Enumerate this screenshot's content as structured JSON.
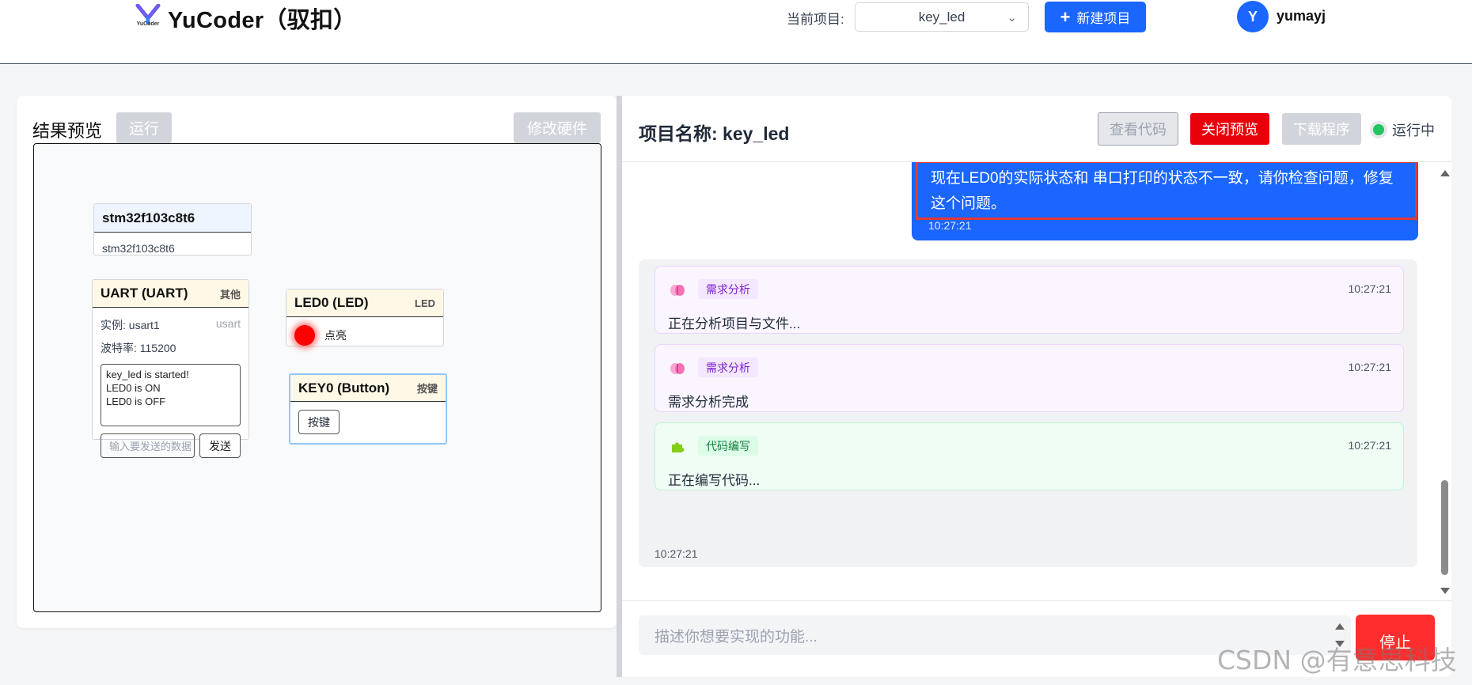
{
  "header": {
    "brand_sub": "YuCoder",
    "app_title": "YuCoder（驭扣）",
    "project_label": "当前项目:",
    "project_value": "key_led",
    "new_project_label": "新建项目",
    "avatar_initial": "Y",
    "username": "yumayj",
    "brand_color": "#1a66ff"
  },
  "left": {
    "title": "结果预览",
    "run_label": "运行",
    "modify_hw_label": "修改硬件",
    "chip": {
      "title": "stm32f103c8t6",
      "body": "stm32f103c8t6"
    },
    "uart": {
      "title": "UART (UART)",
      "tag": "其他",
      "instance_label": "实例: usart1",
      "instance_type": "usart",
      "baud_label": "波特率: 115200",
      "log_lines": [
        "key_led is started!",
        "LED0 is ON",
        "LED0 is OFF"
      ],
      "send_placeholder": "输入要发送的数据",
      "send_label": "发送"
    },
    "led": {
      "title": "LED0 (LED)",
      "tag": "LED",
      "state": "点亮",
      "color": "#ff0000"
    },
    "key": {
      "title": "KEY0 (Button)",
      "tag": "按键",
      "button_label": "按键"
    }
  },
  "right": {
    "title": "项目名称: key_led",
    "view_code_label": "查看代码",
    "close_preview_label": "关闭预览",
    "download_label": "下载程序",
    "status_label": "运行中",
    "user_message": {
      "text": "现在LED0的实际状态和 串口打印的状态不一致，请你检查问题，修复这个问题。",
      "time": "10:27:21"
    },
    "ai_messages": [
      {
        "icon": "brain-icon",
        "badge": "需求分析",
        "time": "10:27:21",
        "text": "正在分析项目与文件..."
      },
      {
        "icon": "brain-icon",
        "badge": "需求分析",
        "time": "10:27:21",
        "text": "需求分析完成"
      },
      {
        "icon": "puzzle-icon",
        "badge": "代码编写",
        "time": "10:27:21",
        "text": "正在编写代码..."
      }
    ],
    "ai_group_time": "10:27:21",
    "input_placeholder": "描述你想要实现的功能...",
    "stop_label": "停止"
  },
  "watermark": "CSDN @有意思科技"
}
